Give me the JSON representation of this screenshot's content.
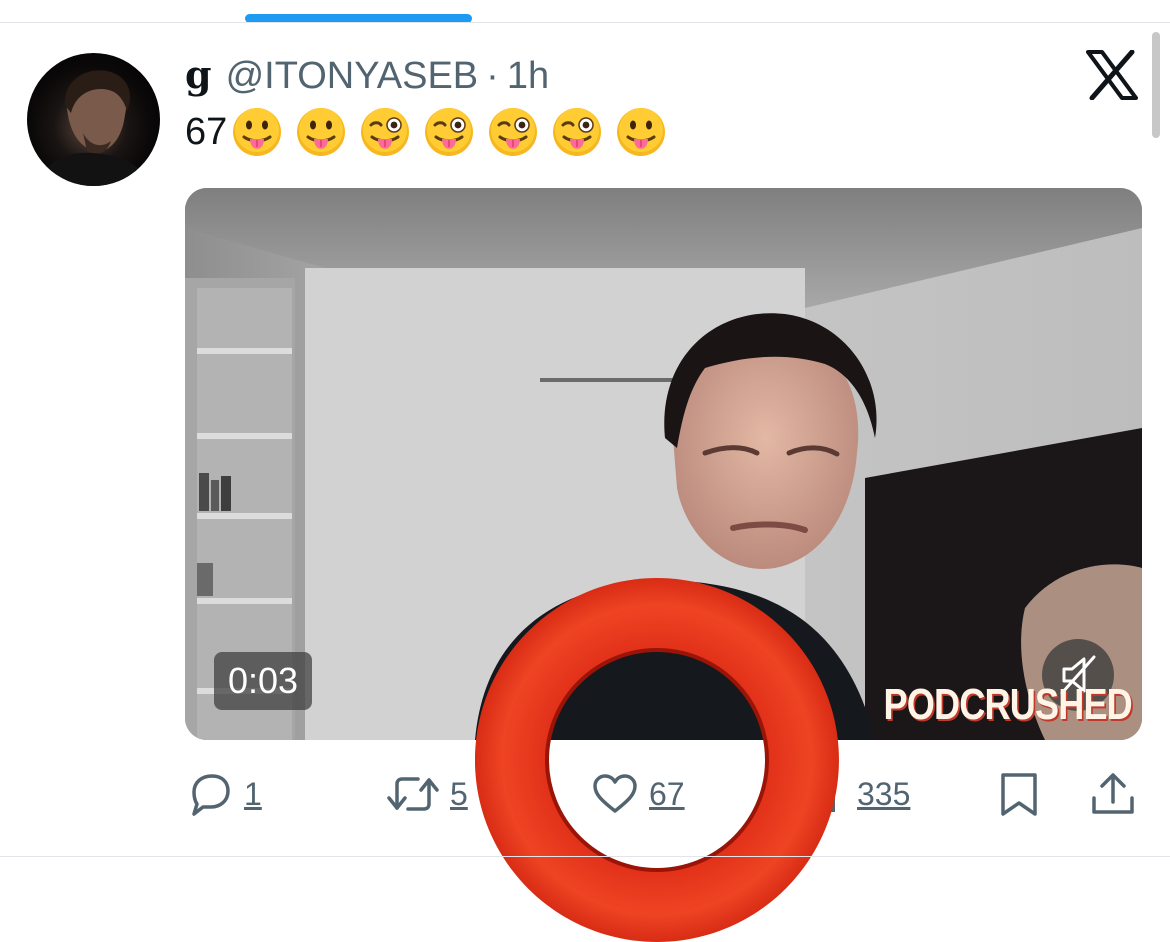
{
  "header": {
    "display_name": "g",
    "handle": "@ITONYASEB",
    "separator": "·",
    "time": "1h"
  },
  "tweet": {
    "text": "67",
    "emojis": [
      "😛",
      "😛",
      "😜",
      "😜",
      "😜",
      "😜",
      "😛"
    ]
  },
  "media": {
    "timestamp": "0:03",
    "watermark": "PODCRUSHED",
    "mute_icon": "speaker-muted-icon"
  },
  "actions": {
    "reply_count": "1",
    "retweet_count": "5",
    "like_count": "67",
    "views_count": "335",
    "icons": [
      "reply-icon",
      "retweet-icon",
      "like-icon",
      "views-icon",
      "bookmark-icon",
      "share-icon"
    ]
  },
  "colors": {
    "accent": "#1d9bf0",
    "secondary_text": "#536471",
    "highlight_ring": "#e2321a"
  }
}
